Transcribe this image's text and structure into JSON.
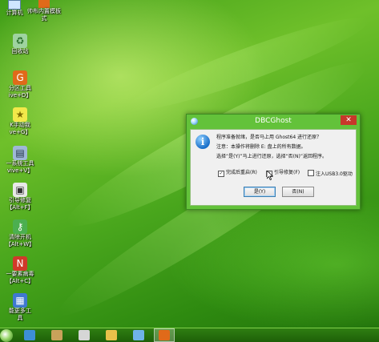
{
  "desktop": {
    "top_icons": [
      {
        "name": "computer",
        "label": "计算机",
        "icon": "computer-icon"
      },
      {
        "name": "partition-tool",
        "label": "帅布内置模板",
        "icon": "partition-icon",
        "label2": "式"
      }
    ],
    "icons": [
      {
        "name": "recycle-bin",
        "line1": "回收站",
        "line2": "",
        "icon": "recycle-bin-icon",
        "color": "#6aa84f"
      },
      {
        "name": "disk-tool",
        "line1": "分区工具",
        "line2": "ive+D】",
        "icon": "disk-partition-icon",
        "color": "#e06a1a"
      },
      {
        "name": "ghost-tool",
        "line1": "K手动我",
        "line2": "ve+G】",
        "icon": "ghost-icon",
        "color": "#f2e84a"
      },
      {
        "name": "system-tool",
        "line1": "一系统工具",
        "line2": "vive+V】",
        "icon": "system-icon",
        "color": "#9fb7d6"
      },
      {
        "name": "boot-repair",
        "line1": "引导修复",
        "line2": "【Alt+F】",
        "icon": "boot-repair-icon",
        "color": "#e8e8e8"
      },
      {
        "name": "password",
        "line1": "清除开机",
        "line2": "【Alt+W】",
        "icon": "key-icon",
        "color": "#4caf50"
      },
      {
        "name": "antivirus",
        "line1": "一要素病毒",
        "line2": "【Alt+C】",
        "icon": "antivirus-icon",
        "color": "#d03a2a"
      },
      {
        "name": "more-tools",
        "line1": "能更多工",
        "line2": "具",
        "icon": "tools-grid-icon",
        "color": "#3f78d0"
      }
    ]
  },
  "dialog": {
    "title": "DBCGhost",
    "close_label": "✕",
    "icon": "info-icon",
    "line1": "程序准备就绪，是否马上用 Ghost64 进行还原？",
    "line2": "注意：本操作将删除 E: 盘上的所有数据。",
    "line3": "选择“是(Y)”马上进行还原，选择“否(N)”返回程序。",
    "checkboxes": [
      {
        "label": "完成后重启(R)",
        "checked": true
      },
      {
        "label": "引导修复(F)",
        "checked": true
      },
      {
        "label": "注入USB3.0驱动",
        "checked": false
      }
    ],
    "yes_label": "是(Y)",
    "no_label": "否(N)"
  },
  "taskbar": {
    "items": [
      {
        "name": "start",
        "icon": "start-orb-icon"
      },
      {
        "name": "explorer",
        "icon": "explorer-icon",
        "color": "#3d8fd6"
      },
      {
        "name": "tools",
        "icon": "tools-icon",
        "color": "#c9a25a"
      },
      {
        "name": "app1",
        "icon": "app-icon",
        "color": "#d6d6d6"
      },
      {
        "name": "app2",
        "icon": "monitor-icon",
        "color": "#6fb3e8"
      },
      {
        "name": "disk-genius",
        "icon": "disk-genius-icon",
        "color": "#e06a1a"
      }
    ]
  }
}
